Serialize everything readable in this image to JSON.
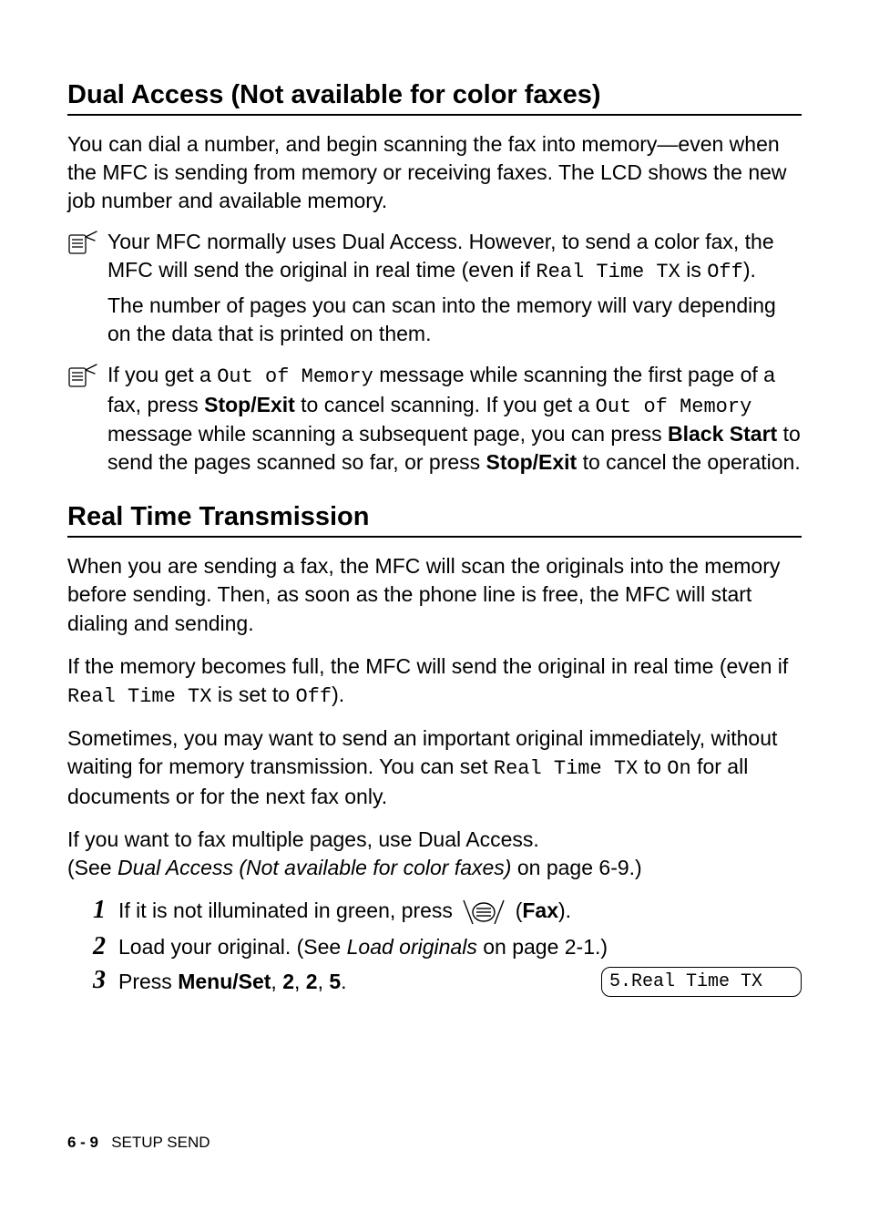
{
  "section1": {
    "title": "Dual Access (Not available for color faxes)",
    "intro": "You can dial a number, and begin scanning the fax into memory—even when the MFC is sending from memory or receiving faxes. The LCD shows the new job number and available memory."
  },
  "note1": {
    "p1a": "Your MFC normally uses Dual Access. However, to send a color fax, the MFC will send the original in real time (even if ",
    "p1mono1": "Real Time TX",
    "p1b": " is ",
    "p1mono2": "Off",
    "p1c": ").",
    "p2": "The number of pages you can scan into the memory will vary depending on the data that is printed on them."
  },
  "note2": {
    "a": "If you get a ",
    "mono1": "Out of Memory",
    "b": " message while scanning the first page of a fax, press ",
    "bold1": "Stop/Exit",
    "c": " to cancel scanning. If you get a ",
    "mono2": "Out of Memory",
    "d": " message while scanning a subsequent page, you can press ",
    "bold2": "Black Start",
    "e": " to send the pages scanned so far, or press ",
    "bold3": "Stop/Exit",
    "f": " to cancel the operation."
  },
  "section2": {
    "title": "Real Time Transmission",
    "p1": "When you are sending a fax, the MFC will scan the originals into the memory before sending. Then, as soon as the phone line is free, the MFC will start dialing and sending.",
    "p2a": "If the memory becomes full, the MFC will send the original in real time (even if ",
    "p2mono1": "Real Time TX",
    "p2b": " is set to ",
    "p2mono2": "Off",
    "p2c": ").",
    "p3a": "Sometimes, you may want to send an important original immediately, without waiting for memory transmission. You can set ",
    "p3mono1": "Real Time TX",
    "p3b": " to ",
    "p3mono2": "On",
    "p3c": " for all documents or for the next fax only.",
    "p4a": "If you want to fax multiple pages, use Dual Access.",
    "p4b": "(See ",
    "p4ital": "Dual Access (Not available for color faxes)",
    "p4c": " on page 6-9.)"
  },
  "steps": {
    "n1": "1",
    "n2": "2",
    "n3": "3",
    "s1a": "If it is not illuminated in green, press ",
    "s1b": " (",
    "s1bold": "Fax",
    "s1c": ").",
    "s2a": "Load your original. (See ",
    "s2ital": "Load originals",
    "s2b": " on page 2-1.)",
    "s3a": "Press ",
    "s3bold": "Menu/Set",
    "s3b": ", ",
    "s3bold2": "2",
    "s3c": ", ",
    "s3bold3": "2",
    "s3d": ", ",
    "s3bold4": "5",
    "s3e": ".",
    "lcd": "5.Real Time TX"
  },
  "footer": {
    "page": "6 - 9",
    "label": "SETUP SEND"
  }
}
